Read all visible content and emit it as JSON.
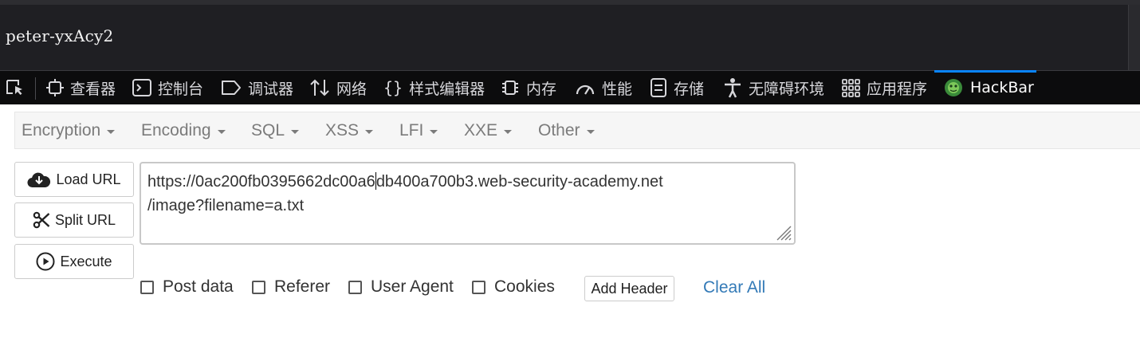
{
  "page": {
    "content_text": "peter-yxAcy2"
  },
  "devtools": {
    "tabs": [
      {
        "label": "查看器",
        "icon": "inspector-icon"
      },
      {
        "label": "控制台",
        "icon": "console-icon"
      },
      {
        "label": "调试器",
        "icon": "debugger-icon"
      },
      {
        "label": "网络",
        "icon": "network-icon"
      },
      {
        "label": "样式编辑器",
        "icon": "style-editor-icon"
      },
      {
        "label": "内存",
        "icon": "memory-icon"
      },
      {
        "label": "性能",
        "icon": "performance-icon"
      },
      {
        "label": "存储",
        "icon": "storage-icon"
      },
      {
        "label": "无障碍环境",
        "icon": "accessibility-icon"
      },
      {
        "label": "应用程序",
        "icon": "application-icon"
      },
      {
        "label": "HackBar",
        "icon": "hackbar-icon",
        "active": true
      }
    ],
    "active_tab_color": "#0a84ff"
  },
  "hackbar": {
    "menus": [
      "Encryption",
      "Encoding",
      "SQL",
      "XSS",
      "LFI",
      "XXE",
      "Other"
    ],
    "buttons": {
      "load_url": "Load URL",
      "split_url": "Split URL",
      "execute": "Execute"
    },
    "url": {
      "line1_before_cursor": "https://0ac200fb0395662dc00a6",
      "line1_after_cursor": "db400a700b3.web-security-academy.net",
      "line2": "/image?filename=a.txt"
    },
    "options": {
      "post_data": "Post data",
      "referer": "Referer",
      "user_agent": "User Agent",
      "cookies": "Cookies"
    },
    "add_header": "Add Header",
    "clear_all": "Clear All",
    "link_color": "#337ab7"
  }
}
